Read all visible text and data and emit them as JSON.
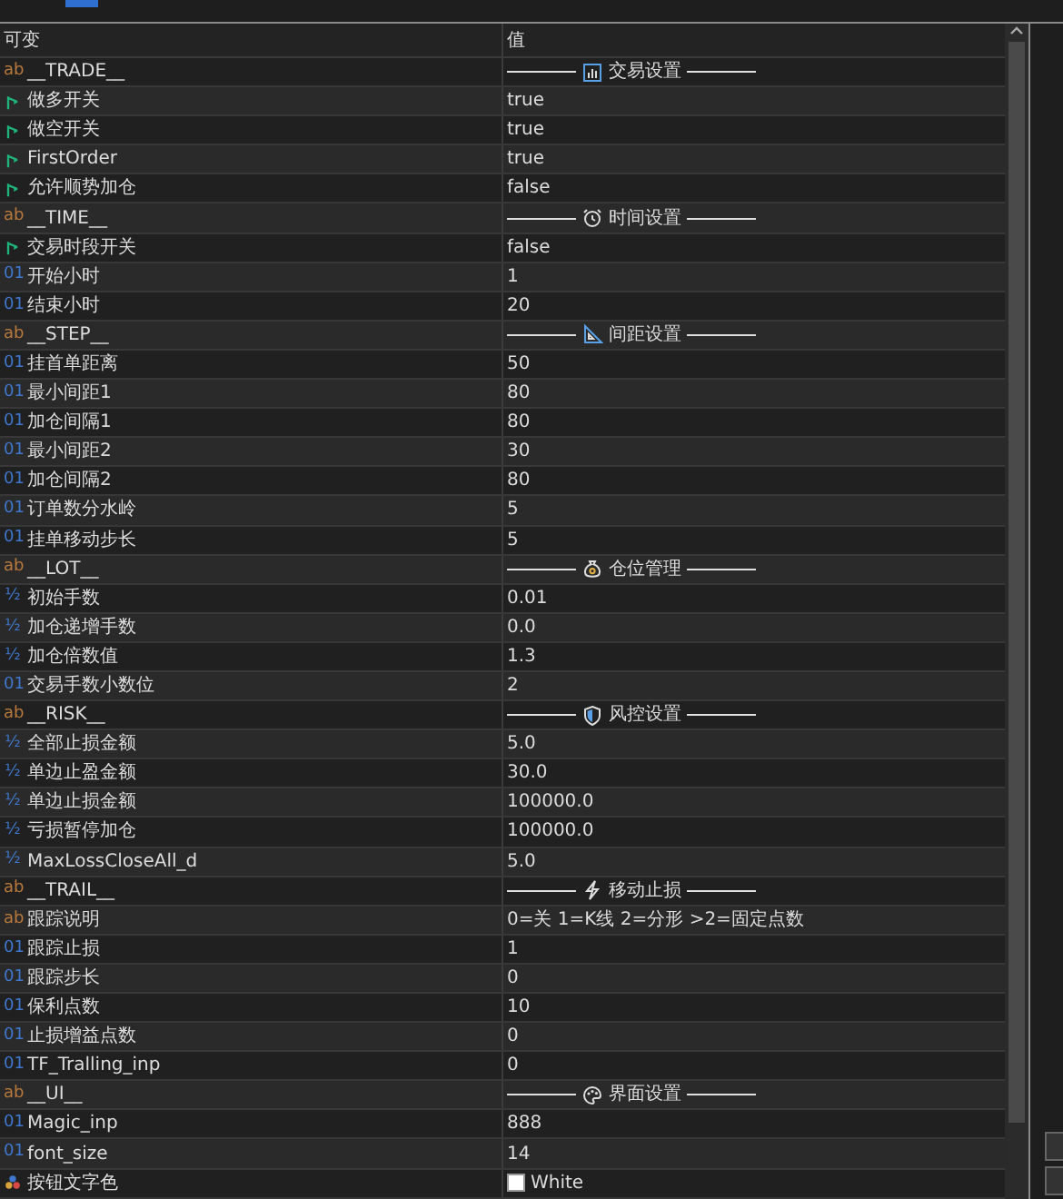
{
  "columns": [
    "可变",
    "值"
  ],
  "rows": [
    {
      "kind": "separator",
      "type": "ab",
      "name": "__TRADE__",
      "title": "交易设置"
    },
    {
      "kind": "bool",
      "name": "做多开关",
      "value": "true"
    },
    {
      "kind": "bool",
      "name": "做空开关",
      "value": "true"
    },
    {
      "kind": "bool",
      "name": "FirstOrder",
      "value": "true"
    },
    {
      "kind": "bool",
      "name": "允许顺势加仓",
      "value": "false"
    },
    {
      "kind": "separator",
      "type": "ab",
      "name": "__TIME__",
      "title": "时间设置"
    },
    {
      "kind": "bool",
      "name": "交易时段开关",
      "value": "false"
    },
    {
      "kind": "int",
      "type": "01",
      "name": "开始小时",
      "value": "1"
    },
    {
      "kind": "int",
      "type": "01",
      "name": "结束小时",
      "value": "20"
    },
    {
      "kind": "separator",
      "type": "ab",
      "name": "__STEP__",
      "title": "间距设置"
    },
    {
      "kind": "int",
      "type": "01",
      "name": "挂首单距离",
      "value": "50"
    },
    {
      "kind": "int",
      "type": "01",
      "name": "最小间距1",
      "value": "80"
    },
    {
      "kind": "int",
      "type": "01",
      "name": "加仓间隔1",
      "value": "80"
    },
    {
      "kind": "int",
      "type": "01",
      "name": "最小间距2",
      "value": "30"
    },
    {
      "kind": "int",
      "type": "01",
      "name": "加仓间隔2",
      "value": "80"
    },
    {
      "kind": "int",
      "type": "01",
      "name": "订单数分水岭",
      "value": "5"
    },
    {
      "kind": "int",
      "type": "01",
      "name": "挂单移动步长",
      "value": "5"
    },
    {
      "kind": "separator",
      "type": "ab",
      "name": "__LOT__",
      "title": "仓位管理"
    },
    {
      "kind": "double",
      "type": "½",
      "name": "初始手数",
      "value": "0.01"
    },
    {
      "kind": "double",
      "type": "½",
      "name": "加仓递增手数",
      "value": "0.0"
    },
    {
      "kind": "double",
      "type": "½",
      "name": "加仓倍数值",
      "value": "1.3"
    },
    {
      "kind": "int",
      "type": "01",
      "name": "交易手数小数位",
      "value": "2"
    },
    {
      "kind": "separator",
      "type": "ab",
      "name": "__RISK__",
      "title": "风控设置"
    },
    {
      "kind": "double",
      "type": "½",
      "name": "全部止损金额",
      "value": "5.0"
    },
    {
      "kind": "double",
      "type": "½",
      "name": "单边止盈金额",
      "value": "30.0"
    },
    {
      "kind": "double",
      "type": "½",
      "name": "单边止损金额",
      "value": "100000.0"
    },
    {
      "kind": "double",
      "type": "½",
      "name": "亏损暂停加仓",
      "value": "100000.0"
    },
    {
      "kind": "double",
      "type": "½",
      "name": "MaxLossCloseAll_d",
      "value": "5.0"
    },
    {
      "kind": "separator",
      "type": "ab",
      "name": "__TRAIL__",
      "title": "移动止损"
    },
    {
      "kind": "string",
      "type": "ab",
      "name": "跟踪说明",
      "value": "0=关 1=K线 2=分形 >2=固定点数"
    },
    {
      "kind": "int",
      "type": "01",
      "name": "跟踪止损",
      "value": "1"
    },
    {
      "kind": "int",
      "type": "01",
      "name": "跟踪步长",
      "value": "0"
    },
    {
      "kind": "int",
      "type": "01",
      "name": "保利点数",
      "value": "10"
    },
    {
      "kind": "int",
      "type": "01",
      "name": "止损增益点数",
      "value": "0"
    },
    {
      "kind": "int",
      "type": "01",
      "name": "TF_Tralling_inp",
      "value": "0"
    },
    {
      "kind": "separator",
      "type": "ab",
      "name": "__UI__",
      "title": "界面设置"
    },
    {
      "kind": "int",
      "type": "01",
      "name": "Magic_inp",
      "value": "888"
    },
    {
      "kind": "int",
      "type": "01",
      "name": "font_size",
      "value": "14"
    },
    {
      "kind": "color",
      "name": "按钮文字色",
      "value": "White",
      "color": "#ffffff"
    }
  ]
}
